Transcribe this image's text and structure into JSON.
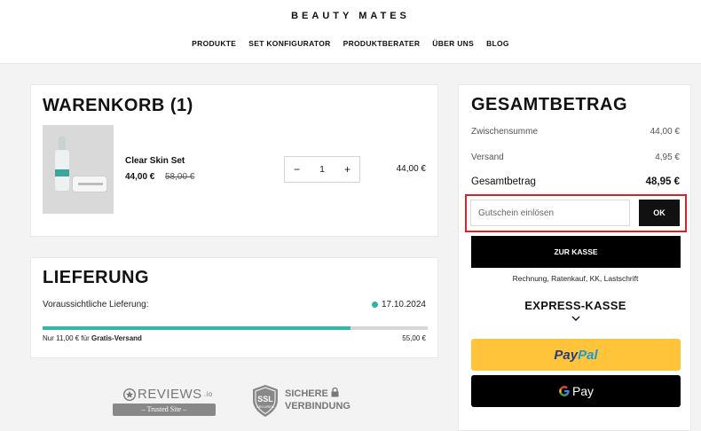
{
  "header": {
    "brand": "BEAUTY MATES",
    "nav": [
      "PRODUKTE",
      "SET KONFIGURATOR",
      "PRODUKTBERATER",
      "ÜBER UNS",
      "BLOG"
    ]
  },
  "cart": {
    "title": "WARENKORB (1)",
    "item": {
      "name": "Clear Skin Set",
      "price": "44,00 €",
      "old_price": "58,00 €",
      "quantity": "1",
      "minus": "−",
      "plus": "+",
      "line_total": "44,00 €"
    }
  },
  "delivery": {
    "title": "LIEFERUNG",
    "label": "Voraussichtliche Lieferung:",
    "date": "17.10.2024",
    "status_color": "#2bb5a0",
    "progress": 0.8,
    "note_prefix": "Nur 11,00 € für ",
    "note_bold": "Gratis-Versand",
    "threshold": "55,00 €"
  },
  "summary": {
    "title": "GESAMTBETRAG",
    "subtotal_label": "Zwischensumme",
    "subtotal": "44,00 €",
    "shipping_label": "Versand",
    "shipping": "4,95 €",
    "total_label": "Gesamtbetrag",
    "total": "48,95 €",
    "coupon_placeholder": "Gutschein einlösen",
    "coupon_button": "OK",
    "checkout_button": "ZUR KASSE",
    "payment_methods": "Rechnung, Ratenkauf, KK, Lastschrift",
    "express_title": "EXPRESS-KASSE",
    "paypal_pay": "Pay",
    "paypal_pal": "Pal",
    "gpay_label": "Pay"
  },
  "badges": {
    "reviews_brand": "REVIEWS",
    "reviews_suffix": ".io",
    "reviews_trusted": "– Trusted Site –",
    "ssl_line1": "SICHERE",
    "ssl_line2": "VERBINDUNG",
    "ssl_shield_top": "SSL",
    "ssl_shield_bottom": "SECURED"
  },
  "colors": {
    "accent_teal": "#35b7a5",
    "highlight_red": "#d6222a",
    "paypal_yellow": "#ffc439"
  }
}
